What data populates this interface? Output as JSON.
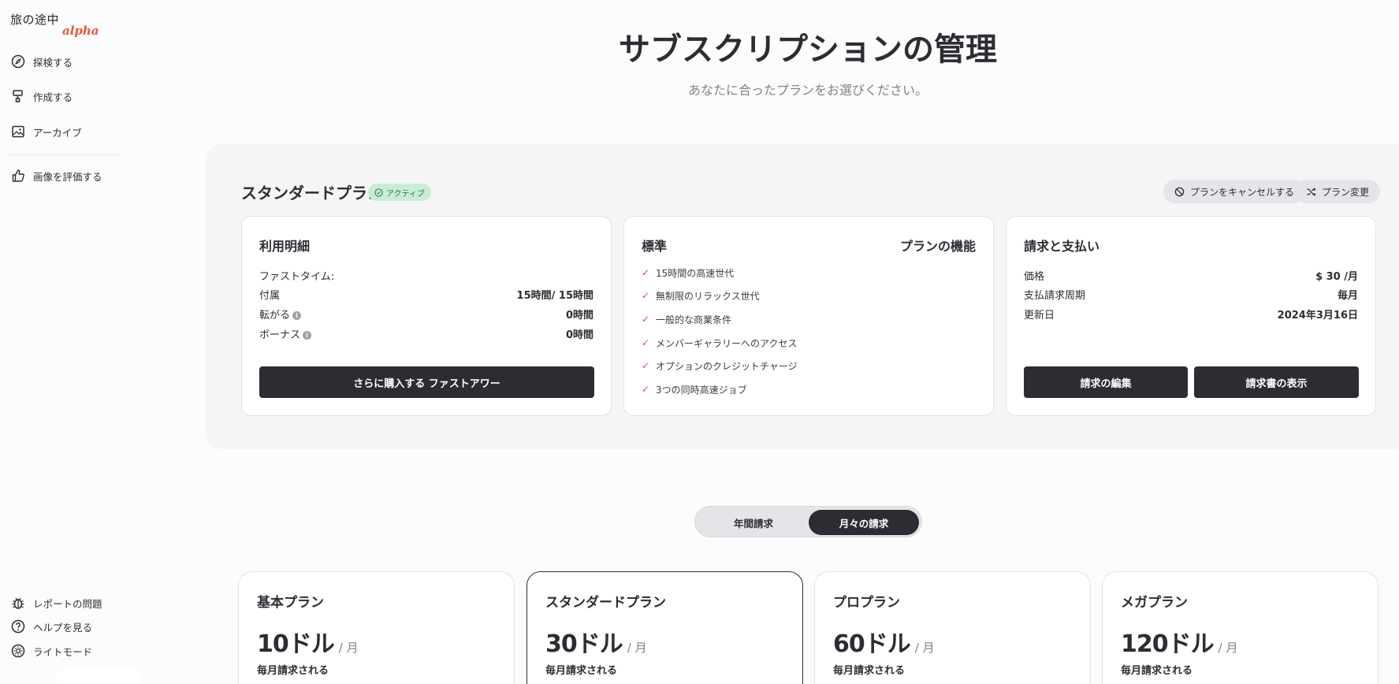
{
  "sidebar": {
    "brand": "旅の途中",
    "brand_tag": "alpha",
    "items": [
      {
        "label": "探検する"
      },
      {
        "label": "作成する"
      },
      {
        "label": "アーカイブ"
      },
      {
        "label": "画像を評価する"
      }
    ],
    "bottom_items": [
      {
        "label": "レポートの問題"
      },
      {
        "label": "ヘルプを見る"
      },
      {
        "label": "ライトモード"
      }
    ]
  },
  "header": {
    "title": "サブスクリプションの管理",
    "subtitle": "あなたに合ったプランをお選びください。"
  },
  "current_plan": {
    "name": "スタンダードプラン",
    "status": "アクティブ",
    "cancel_label": "プランをキャンセルする",
    "change_label": "プラン変更",
    "usage": {
      "title": "利用明細",
      "fast_time_label": "ファストタイム:",
      "rows": [
        {
          "label": "付属",
          "value": "15時間/ 15時間"
        },
        {
          "label": "転がる",
          "value": "0時間"
        },
        {
          "label": "ボーナス",
          "value": "0時間"
        }
      ],
      "buy_label": "さらに購入する ファストアワー"
    },
    "features": {
      "title": "標準",
      "title_right": "プランの機能",
      "items": [
        "15時間の高速世代",
        "無制限のリラックス世代",
        "一般的な商業条件",
        "メンバーギャラリーへのアクセス",
        "オプションのクレジットチャージ",
        "3つの同時高速ジョブ"
      ]
    },
    "billing": {
      "title": "請求と支払い",
      "rows": [
        {
          "label": "価格",
          "value": "$ 30 /月"
        },
        {
          "label": "支払請求周期",
          "value": "毎月"
        },
        {
          "label": "更新日",
          "value": "2024年3月16日"
        }
      ],
      "edit_label": "請求の編集",
      "invoice_label": "請求書の表示"
    }
  },
  "billing_toggle": {
    "annual": "年間請求",
    "monthly": "月々の請求",
    "selected": "monthly"
  },
  "plans": [
    {
      "name": "基本プラン",
      "price": "10ドル",
      "unit": "/ 月",
      "note": "毎月請求される"
    },
    {
      "name": "スタンダードプラン",
      "price": "30ドル",
      "unit": "/ 月",
      "note": "毎月請求される"
    },
    {
      "name": "プロプラン",
      "price": "60ドル",
      "unit": "/ 月",
      "note": "毎月請求される"
    },
    {
      "name": "メガプラン",
      "price": "120ドル",
      "unit": "/ 月",
      "note": "毎月請求される"
    }
  ],
  "colors": {
    "dark": "#2b2d33",
    "accent_brand": "#e8553a",
    "active_badge_bg": "#c9ecd9",
    "check": "#e0453a"
  }
}
